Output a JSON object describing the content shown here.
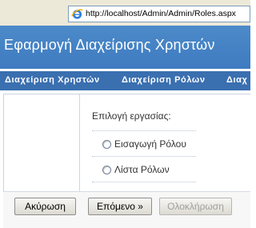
{
  "browser": {
    "url": "http://localhost/Admin/Admin/Roles.aspx"
  },
  "header": {
    "title": "Εφαρμογή Διαχείρισης Χρηστών"
  },
  "menu": {
    "items": [
      {
        "label": "Διαχείριση Χρηστών"
      },
      {
        "label": "Διαχείριση Ρόλων"
      },
      {
        "label": "Διαχ"
      }
    ]
  },
  "wizard": {
    "prompt": "Επιλογή εργασίας:",
    "options": [
      {
        "label": "Εισαγωγή Ρόλου",
        "selected": false
      },
      {
        "label": "Λίστα Ρόλων",
        "selected": false
      }
    ],
    "buttons": {
      "cancel": "Ακύρωση",
      "next": "Επόμενο »",
      "finish": "Ολοκλήρωση"
    }
  },
  "colors": {
    "banner": "#3e7bc0",
    "menubar": "#3a6fb0"
  }
}
